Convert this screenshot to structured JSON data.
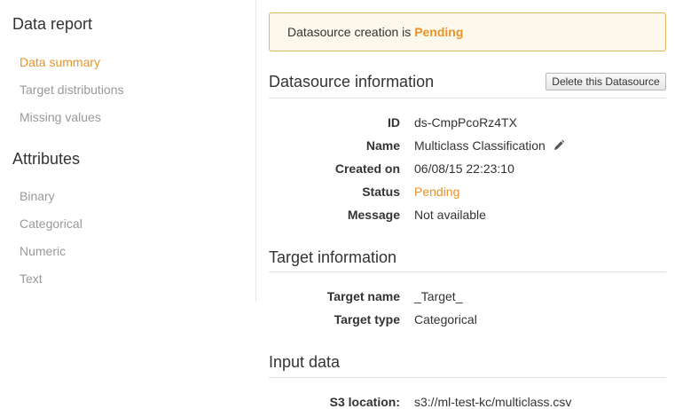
{
  "sidebar": {
    "data_report_heading": "Data report",
    "data_report_items": [
      {
        "label": "Data summary"
      },
      {
        "label": "Target distributions"
      },
      {
        "label": "Missing values"
      }
    ],
    "attributes_heading": "Attributes",
    "attribute_items": [
      {
        "label": "Binary"
      },
      {
        "label": "Categorical"
      },
      {
        "label": "Numeric"
      },
      {
        "label": "Text"
      }
    ]
  },
  "banner": {
    "text": "Datasource creation is",
    "status": "Pending"
  },
  "datasource_info": {
    "title": "Datasource information",
    "delete_button": "Delete this Datasource",
    "fields": [
      {
        "label": "ID",
        "value": "ds-CmpPcoRz4TX"
      },
      {
        "label": "Name",
        "value": "Multiclass Classification"
      },
      {
        "label": "Created on",
        "value": "06/08/15 22:23:10"
      },
      {
        "label": "Status",
        "value": "Pending"
      },
      {
        "label": "Message",
        "value": "Not available"
      }
    ]
  },
  "target_info": {
    "title": "Target information",
    "fields": [
      {
        "label": "Target name",
        "value": "_Target_"
      },
      {
        "label": "Target type",
        "value": "Categorical"
      }
    ]
  },
  "input_data": {
    "title": "Input data",
    "fields": [
      {
        "label": "S3 location:",
        "value": "s3://ml-test-kc/multiclass.csv"
      }
    ]
  },
  "colors": {
    "accent": "#e8932a",
    "banner_border": "#e3b85d",
    "banner_bg": "#fdf8ec"
  }
}
